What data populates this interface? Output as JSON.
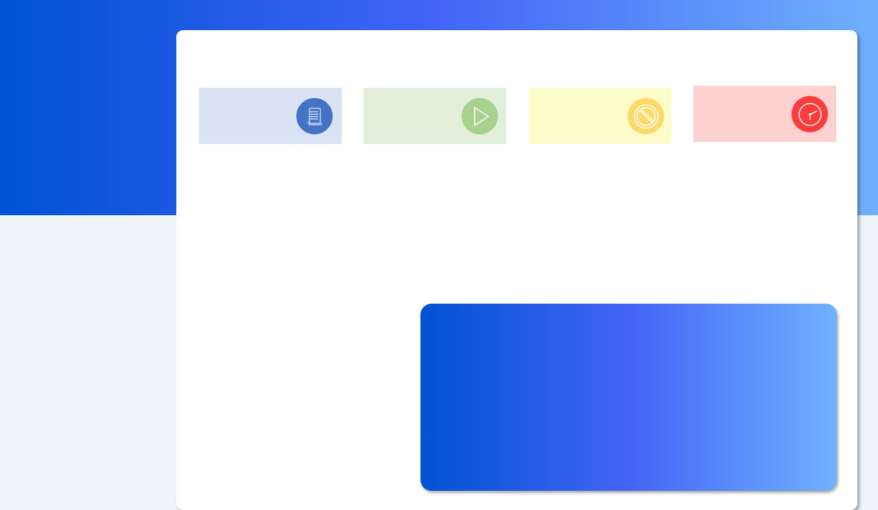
{
  "theme": {
    "hero_gradient": [
      "#0052d4",
      "#4364f7",
      "#6fb1fc"
    ],
    "page_background": "#eff4f9",
    "panel_background": "#ffffff"
  },
  "stat_cards": [
    {
      "name": "card-documents",
      "icon": "document-list-icon",
      "background": "#dae3f3",
      "accent": "#4472c4"
    },
    {
      "name": "card-play",
      "icon": "play-icon",
      "background": "#e2efda",
      "accent": "#a9d18e"
    },
    {
      "name": "card-blocked",
      "icon": "blocked-icon",
      "background": "#fdfbca",
      "accent": "#ffd966"
    },
    {
      "name": "card-time",
      "icon": "clock-icon",
      "background": "#ffd0d0",
      "accent": "#ff3b3b"
    }
  ],
  "feature_box": {
    "gradient": [
      "#0052d4",
      "#4364f7",
      "#6fb1fc"
    ]
  }
}
